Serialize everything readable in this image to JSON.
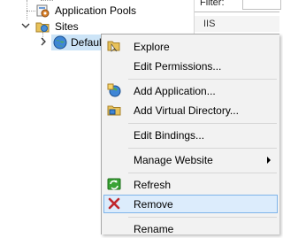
{
  "tree": {
    "nodes": [
      {
        "label": "Application Pools",
        "icon": "application-pools-icon"
      },
      {
        "label": "Sites",
        "icon": "sites-folder-icon"
      },
      {
        "label": "Default",
        "icon": "globe-icon"
      }
    ]
  },
  "right_pane": {
    "filter_label": "Filter:",
    "header_label": "IIS"
  },
  "context_menu": {
    "items": [
      {
        "label": "Explore",
        "icon": "folder-icon"
      },
      {
        "label": "Edit Permissions..."
      },
      {
        "label": "Add Application...",
        "icon": "add-application-icon"
      },
      {
        "label": "Add Virtual Directory...",
        "icon": "add-virtual-directory-icon"
      },
      {
        "label": "Edit Bindings..."
      },
      {
        "label": "Manage Website",
        "has_submenu": true
      },
      {
        "label": "Refresh",
        "icon": "refresh-icon"
      },
      {
        "label": "Remove",
        "icon": "remove-x-icon",
        "selected": true
      },
      {
        "label": "Rename"
      }
    ]
  },
  "colors": {
    "menu_background": "#f2f2f2",
    "selection_fill": "#dcecfc",
    "selection_border": "#7eb4ea",
    "remove_icon": "#c0272d",
    "refresh_icon": "#3aa335"
  }
}
